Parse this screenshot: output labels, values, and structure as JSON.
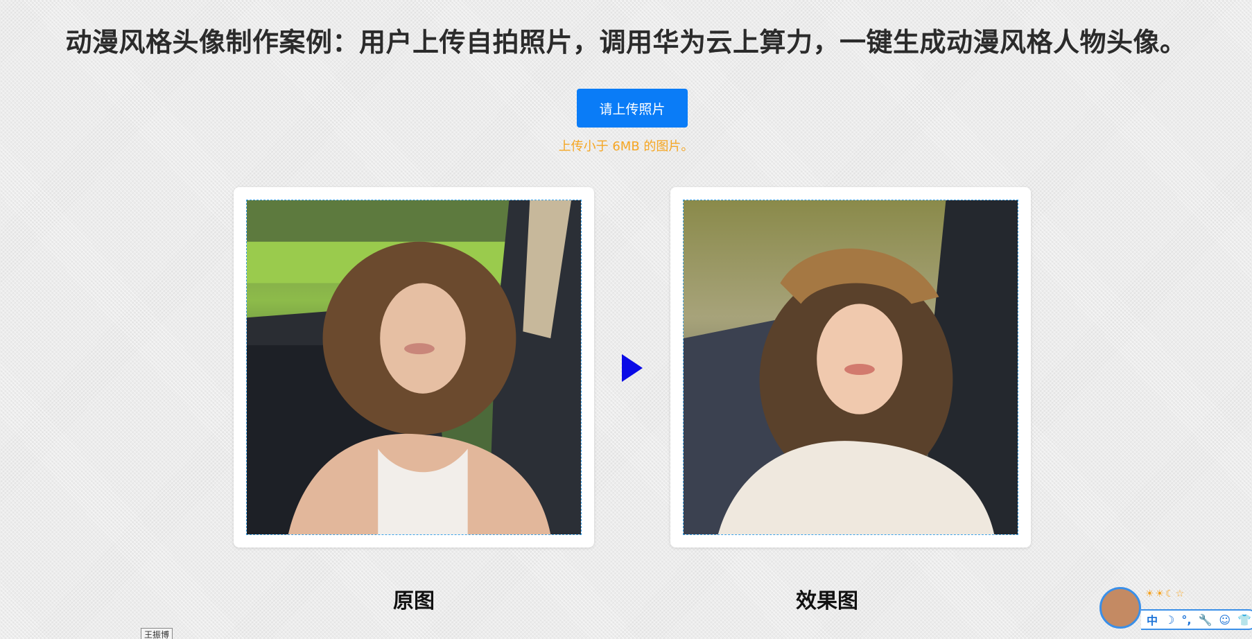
{
  "page": {
    "title": "动漫风格头像制作案例：用户上传自拍照片，调用华为云上算力，一键生成动漫风格人物头像。"
  },
  "upload": {
    "button_label": "请上传照片",
    "hint": "上传小于 6MB 的图片。"
  },
  "panels": {
    "original_caption": "原图",
    "result_caption": "效果图"
  },
  "overlay": {
    "small_label": "王振博",
    "ime_suns": "☀☀☾☆",
    "ime_items": [
      "中",
      "☽",
      "°,",
      "🔧",
      "☺",
      "👕"
    ]
  },
  "colors": {
    "accent": "#0a7cf7",
    "hint": "#f5a623",
    "arrow": "#0a0ae6"
  },
  "icons": {
    "arrow": "play-arrow-icon"
  }
}
